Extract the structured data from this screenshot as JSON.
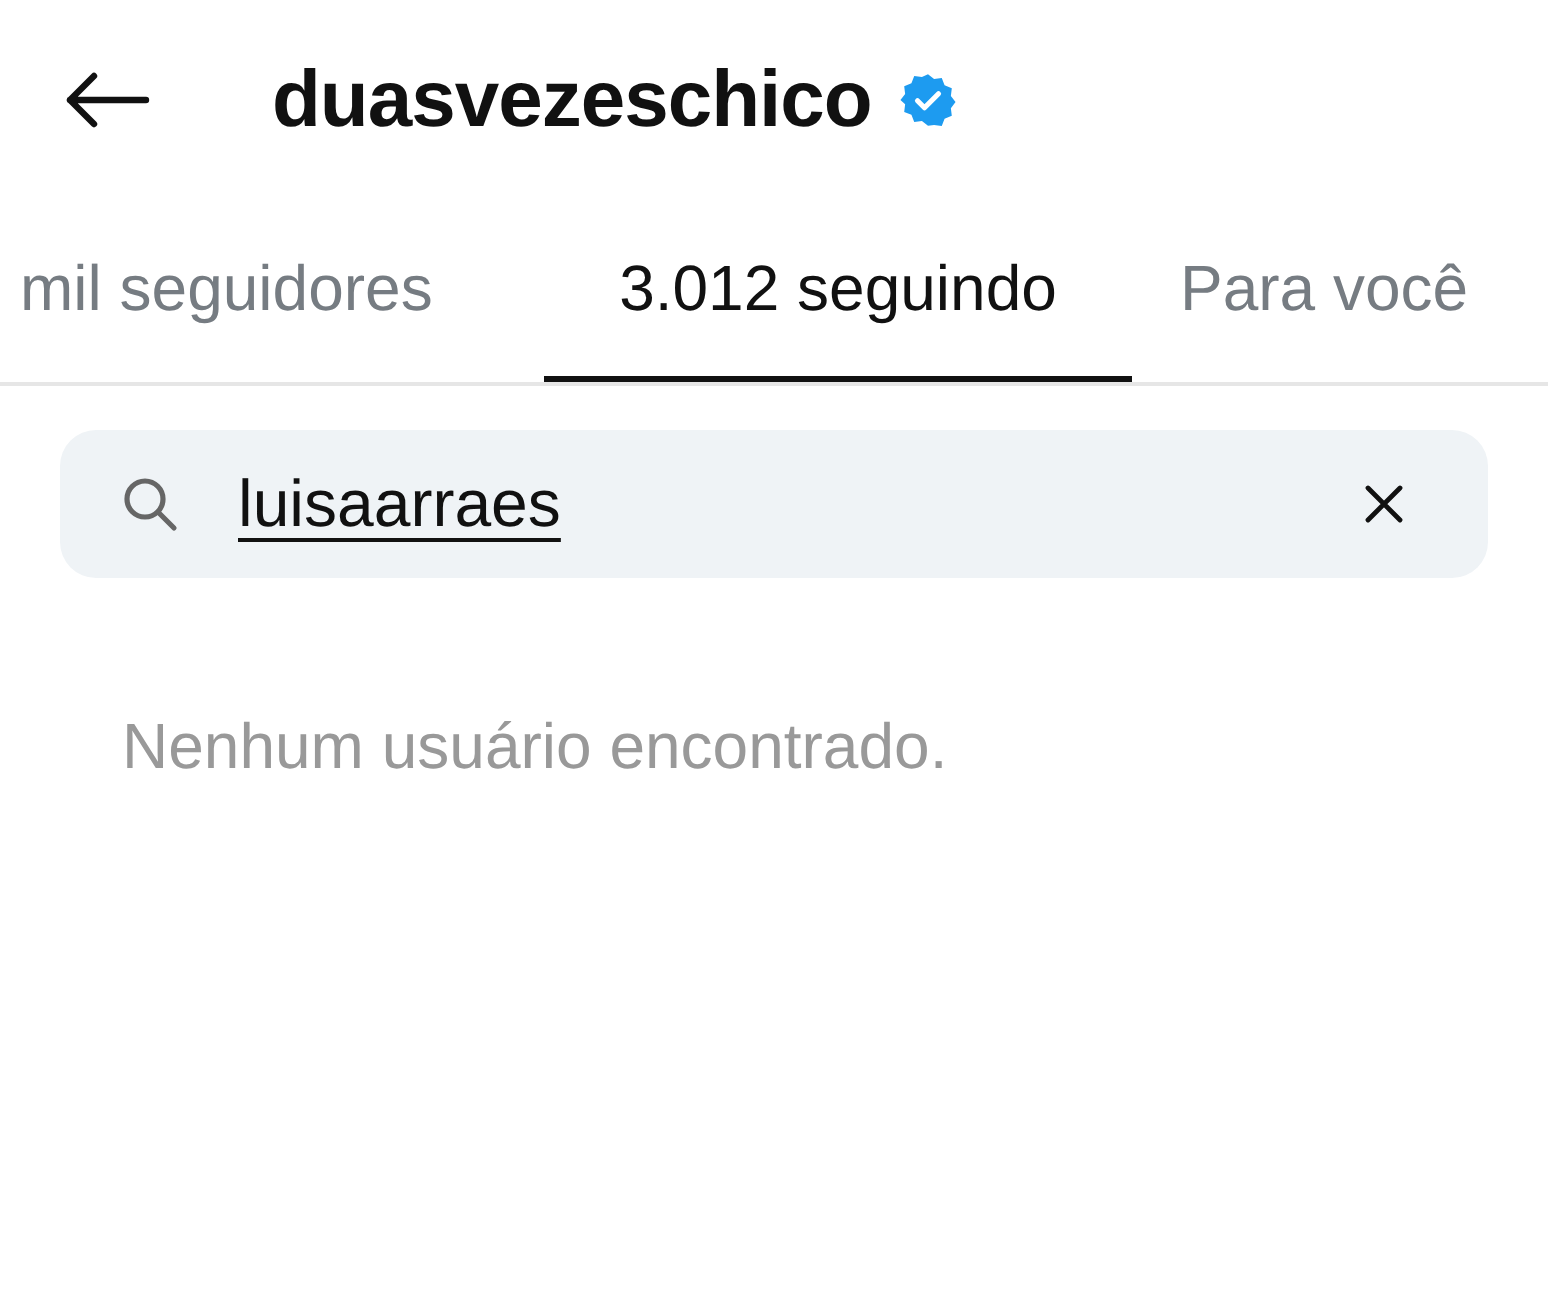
{
  "header": {
    "title": "duasvezeschico",
    "verified": true
  },
  "tabs": [
    {
      "label": "mil seguidores",
      "selected": false
    },
    {
      "label": "3.012 seguindo",
      "selected": true
    },
    {
      "label": "Para você",
      "selected": false
    }
  ],
  "search": {
    "value": "luisaarraes"
  },
  "message": "Nenhum usuário encontrado."
}
